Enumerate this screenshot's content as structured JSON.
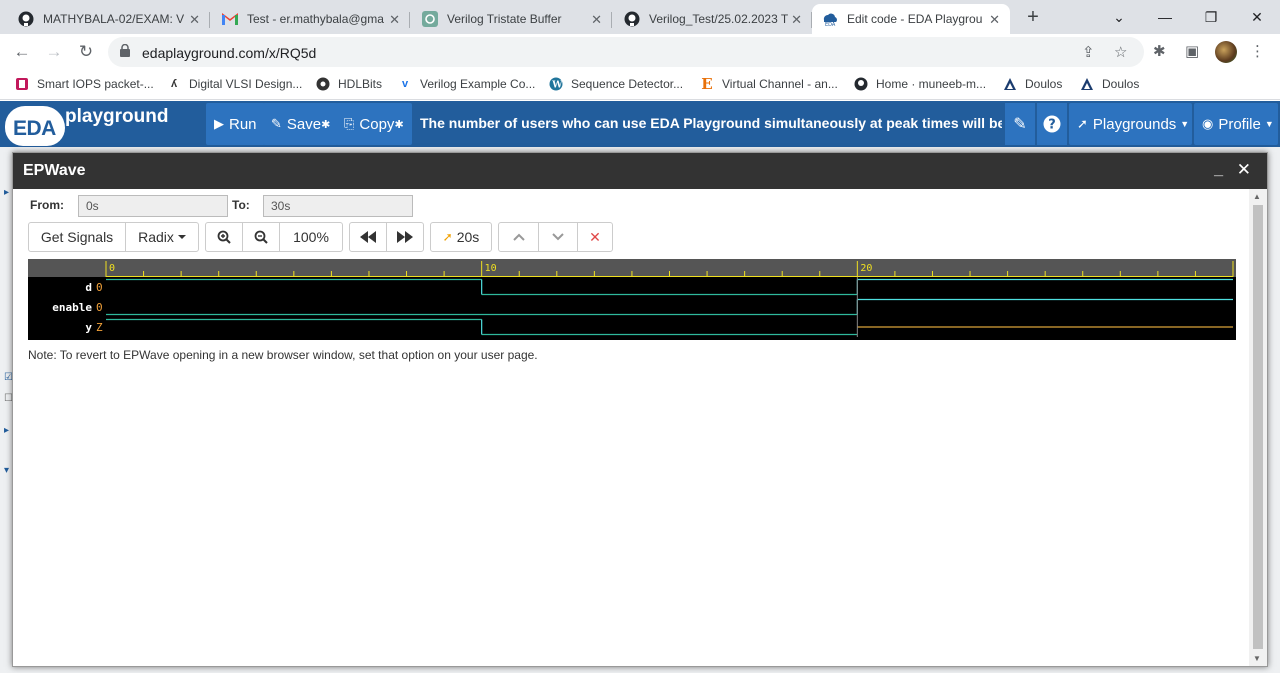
{
  "browser": {
    "tabs": [
      {
        "title": "MATHYBALA-02/EXAM: V",
        "icon": "github-icon"
      },
      {
        "title": "Test - er.mathybala@gma",
        "icon": "gmail-icon"
      },
      {
        "title": "Verilog Tristate Buffer",
        "icon": "chatgpt-icon"
      },
      {
        "title": "Verilog_Test/25.02.2023 T",
        "icon": "github-icon"
      },
      {
        "title": "Edit code - EDA Playgrou",
        "icon": "eda-icon"
      }
    ],
    "url": "edaplayground.com/x/RQ5d",
    "bookmarks": [
      {
        "label": "Smart IOPS packet-...",
        "icon": "bookmark-icon"
      },
      {
        "label": "Digital VLSI Design...",
        "icon": "vlsi-icon"
      },
      {
        "label": "HDLBits",
        "icon": "hdlbits-icon"
      },
      {
        "label": "Verilog Example Co...",
        "icon": "verilog-icon"
      },
      {
        "label": "Sequence Detector...",
        "icon": "wordpress-icon"
      },
      {
        "label": "Virtual Channel - an...",
        "icon": "e-icon"
      },
      {
        "label": "Home · muneeb-m...",
        "icon": "github-icon"
      },
      {
        "label": "Doulos",
        "icon": "doulos-icon"
      },
      {
        "label": "Doulos",
        "icon": "doulos-icon"
      }
    ]
  },
  "eda": {
    "logo_main": "EDA",
    "logo_sub": "playground",
    "run_label": "Run",
    "save_label": "Save",
    "copy_label": "Copy",
    "message": "The number of users who can use EDA Playground simultaneously at peak times will be restricted for",
    "playgrounds_label": "Playgrounds",
    "profile_label": "Profile"
  },
  "epwave": {
    "title": "EPWave",
    "from_label": "From:",
    "from_value": "0s",
    "to_label": "To:",
    "to_value": "30s",
    "get_signals_label": "Get Signals",
    "radix_label": "Radix",
    "zoom_level": "100%",
    "cursor_time": "20s",
    "note": "Note: To revert to EPWave opening in a new browser window, set that option on your user page.",
    "time_range": [
      0,
      30
    ],
    "ruler_labels": [
      "0",
      "10",
      "20"
    ],
    "signals": [
      {
        "name": "d",
        "value": "0",
        "transitions": [
          [
            0,
            1
          ],
          [
            10,
            0
          ],
          [
            20,
            1
          ]
        ]
      },
      {
        "name": "enable",
        "value": "0",
        "transitions": [
          [
            0,
            0
          ],
          [
            20,
            1
          ]
        ]
      },
      {
        "name": "y",
        "value": "Z",
        "transitions": [
          [
            0,
            1
          ],
          [
            10,
            0
          ],
          [
            20,
            "Z"
          ]
        ]
      }
    ],
    "colors": {
      "wave": "#2fb89c",
      "wave_high": "#4fe0e0",
      "z_line": "#d9a23a",
      "ruler_text": "#f0e020",
      "value_text": "#f3a23a"
    }
  }
}
